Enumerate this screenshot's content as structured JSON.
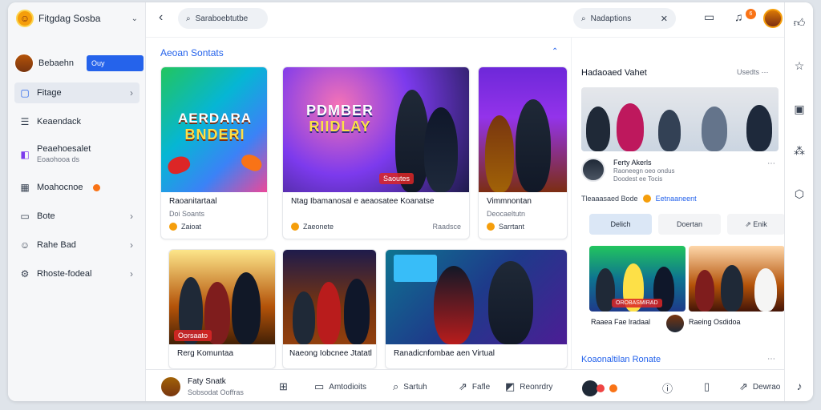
{
  "brand": {
    "name": "Fitgdag Sosba"
  },
  "profile": {
    "name": "Bebaehn",
    "badge": "Ouy"
  },
  "sidebar": {
    "items": [
      {
        "label": "Fitage",
        "sub": ""
      },
      {
        "label": "Keaendack",
        "sub": ""
      },
      {
        "label": "Peaehoesalet",
        "sub": "Eoaohooa ds"
      },
      {
        "label": "Moahocnoe",
        "sub": ""
      },
      {
        "label": "Bote",
        "sub": ""
      },
      {
        "label": "Rahe Bad",
        "sub": ""
      },
      {
        "label": "Rhoste-fodeal",
        "sub": ""
      }
    ]
  },
  "topbar": {
    "search_left": "Saraboebtutbe",
    "search_right": "Nadaptions",
    "notification_count": "6"
  },
  "main": {
    "section_title": "Aeoan Sontats",
    "cards": [
      {
        "overlay_line1": "AERDARA",
        "overlay_line2": "BNDERI",
        "title": "Raoanitartaal",
        "sub": "Doi Soants",
        "meta": "Zaioat",
        "right": ""
      },
      {
        "overlay_line1": "PDMBER",
        "overlay_line2": "RIIDLAY",
        "tag": "Saoutes",
        "title": "Ntag Ibamanosal e aeaosatee Koanatse",
        "sub": "",
        "meta": "Zaeonete",
        "right": "Raadsce"
      },
      {
        "title": "Vimmnontan",
        "sub": "Deocaeltutn",
        "meta": "Sarrtant",
        "right": ""
      },
      {
        "tag": "Oorsaato",
        "title": "Rerg Komuntaa",
        "sub": ""
      },
      {
        "title": "Naeong Iobcnee Jtatatl",
        "sub": ""
      },
      {
        "title": "Ranadicnfombae aen Virtual",
        "sub": ""
      }
    ]
  },
  "bottombar": {
    "name": "Faty Snatk",
    "sub": "Sobsodat Ooffras",
    "items": [
      "Amtodioits",
      "Sartuh",
      "Fafle",
      "Reonrdry",
      "Dewrao"
    ]
  },
  "panel": {
    "title": "Hadaoaed Vahet",
    "more": "Usedts",
    "user_name": "Ferty Akerls",
    "user_sub": "Raoneegn oeo ondus",
    "user_sub2": "Doodest ee Tocis",
    "stats_text": "Tleaaasaed Bode",
    "stats_blue": "Eetnaaneent",
    "buttons": [
      "Delich",
      "Doertan",
      "Enik"
    ],
    "thumb1_tag": "OROBASMIRAD",
    "thumb1_caption": "Raaea Fae lradaal",
    "thumb2_caption": "Raeing Osdidoa",
    "section": "Koaonaltilan Ronate"
  }
}
